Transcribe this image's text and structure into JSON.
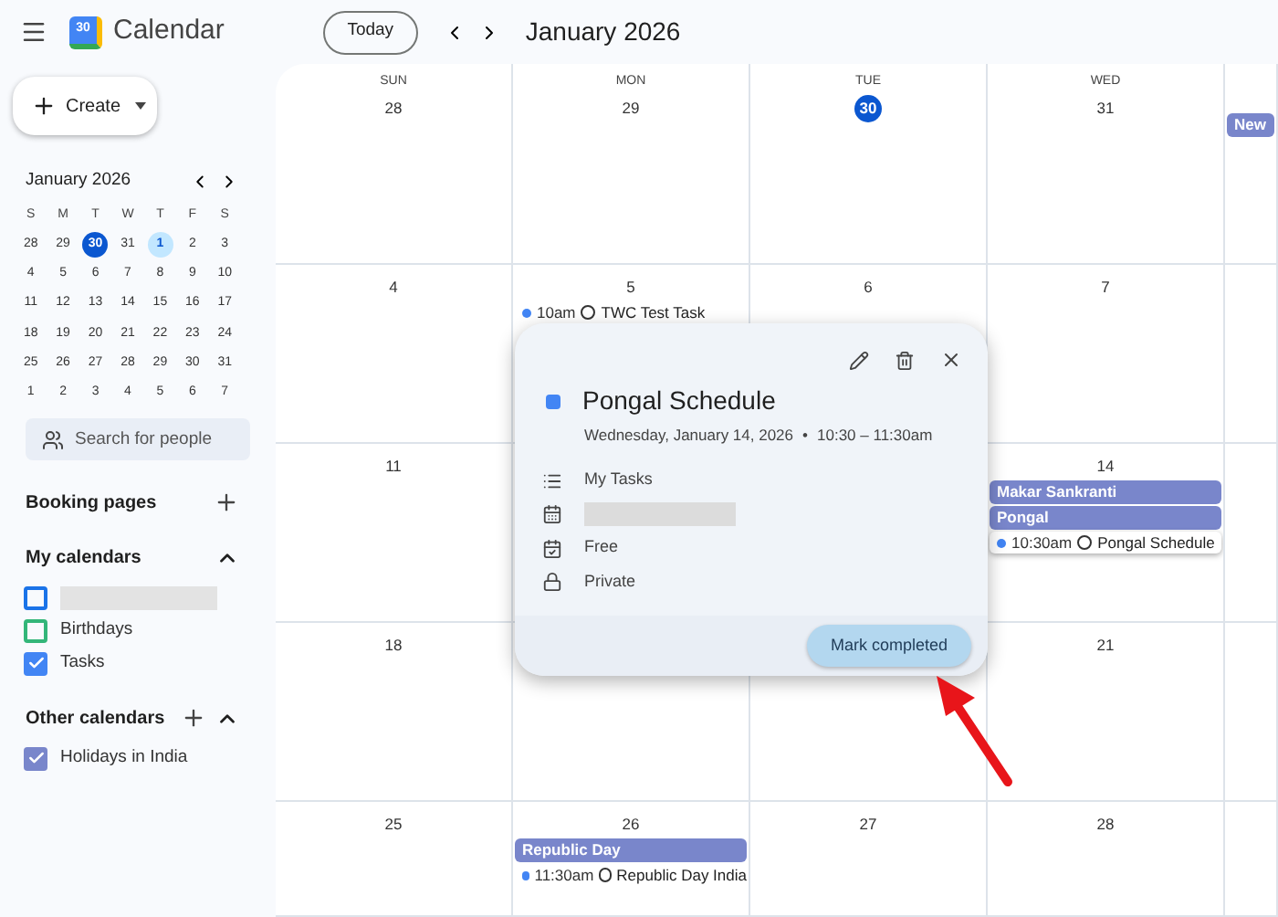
{
  "header": {
    "logo_text": "30",
    "app_name": "Calendar",
    "today_button": "Today",
    "period": "January 2026"
  },
  "sidebar": {
    "create_button": "Create",
    "mini_calendar": {
      "title": "January 2026",
      "weekdays": [
        "S",
        "M",
        "T",
        "W",
        "T",
        "F",
        "S"
      ],
      "weeks": [
        [
          {
            "day": "28",
            "today": false,
            "selected": false
          },
          {
            "day": "29",
            "today": false,
            "selected": false
          },
          {
            "day": "30",
            "today": true,
            "selected": false
          },
          {
            "day": "31",
            "today": false,
            "selected": false
          },
          {
            "day": "1",
            "today": false,
            "selected": true
          },
          {
            "day": "2",
            "today": false,
            "selected": false
          },
          {
            "day": "3",
            "today": false,
            "selected": false
          }
        ],
        [
          {
            "day": "4",
            "today": false,
            "selected": false
          },
          {
            "day": "5",
            "today": false,
            "selected": false
          },
          {
            "day": "6",
            "today": false,
            "selected": false
          },
          {
            "day": "7",
            "today": false,
            "selected": false
          },
          {
            "day": "8",
            "today": false,
            "selected": false
          },
          {
            "day": "9",
            "today": false,
            "selected": false
          },
          {
            "day": "10",
            "today": false,
            "selected": false
          }
        ],
        [
          {
            "day": "11",
            "today": false,
            "selected": false
          },
          {
            "day": "12",
            "today": false,
            "selected": false
          },
          {
            "day": "13",
            "today": false,
            "selected": false
          },
          {
            "day": "14",
            "today": false,
            "selected": false
          },
          {
            "day": "15",
            "today": false,
            "selected": false
          },
          {
            "day": "16",
            "today": false,
            "selected": false
          },
          {
            "day": "17",
            "today": false,
            "selected": false
          }
        ],
        [
          {
            "day": "18",
            "today": false,
            "selected": false
          },
          {
            "day": "19",
            "today": false,
            "selected": false
          },
          {
            "day": "20",
            "today": false,
            "selected": false
          },
          {
            "day": "21",
            "today": false,
            "selected": false
          },
          {
            "day": "22",
            "today": false,
            "selected": false
          },
          {
            "day": "23",
            "today": false,
            "selected": false
          },
          {
            "day": "24",
            "today": false,
            "selected": false
          }
        ],
        [
          {
            "day": "25",
            "today": false,
            "selected": false
          },
          {
            "day": "26",
            "today": false,
            "selected": false
          },
          {
            "day": "27",
            "today": false,
            "selected": false
          },
          {
            "day": "28",
            "today": false,
            "selected": false
          },
          {
            "day": "29",
            "today": false,
            "selected": false
          },
          {
            "day": "30",
            "today": false,
            "selected": false
          },
          {
            "day": "31",
            "today": false,
            "selected": false
          }
        ],
        [
          {
            "day": "1",
            "today": false,
            "selected": false
          },
          {
            "day": "2",
            "today": false,
            "selected": false
          },
          {
            "day": "3",
            "today": false,
            "selected": false
          },
          {
            "day": "4",
            "today": false,
            "selected": false
          },
          {
            "day": "5",
            "today": false,
            "selected": false
          },
          {
            "day": "6",
            "today": false,
            "selected": false
          },
          {
            "day": "7",
            "today": false,
            "selected": false
          }
        ]
      ]
    },
    "search_placeholder": "Search for people",
    "booking_pages": "Booking pages",
    "my_calendars": {
      "title": "My calendars",
      "expanded": true,
      "items": [
        {
          "redacted": true,
          "checked": false,
          "color": "#1a73e8"
        },
        {
          "label": "Birthdays",
          "checked": false,
          "color": "#33b679"
        },
        {
          "label": "Tasks",
          "checked": true,
          "color": "#4285f4"
        }
      ]
    },
    "other_calendars": {
      "title": "Other calendars",
      "expanded": true,
      "items": [
        {
          "label": "Holidays in India",
          "checked": true,
          "color": "#7986cb"
        }
      ]
    }
  },
  "calendar": {
    "weeks": [
      {
        "cells": [
          {
            "weekday": "SUN",
            "date": "28",
            "today": false
          },
          {
            "weekday": "MON",
            "date": "29",
            "today": false
          },
          {
            "weekday": "TUE",
            "date": "30",
            "today": true
          },
          {
            "weekday": "WED",
            "date": "31",
            "today": false
          },
          {
            "events": [
              {
                "kind": "allday",
                "title": "New",
                "color": "#7986cb"
              }
            ]
          }
        ]
      },
      {
        "cells": [
          {
            "date": "4",
            "today": false
          },
          {
            "date": "5",
            "today": false,
            "events": [
              {
                "kind": "task",
                "time": "10am",
                "title": "TWC Test Task",
                "color": "#4285f4",
                "selected": false
              }
            ]
          },
          {
            "date": "6",
            "today": false
          },
          {
            "date": "7",
            "today": false
          },
          {}
        ]
      },
      {
        "cells": [
          {
            "date": "11",
            "today": false
          },
          {},
          {},
          {
            "date": "14",
            "today": false,
            "events": [
              {
                "kind": "allday",
                "title": "Makar Sankranti",
                "color": "#7986cb"
              },
              {
                "kind": "allday",
                "title": "Pongal",
                "color": "#7986cb"
              },
              {
                "kind": "task",
                "time": "10:30am",
                "title": "Pongal Schedule",
                "color": "#4285f4",
                "selected": true
              }
            ]
          },
          {}
        ]
      },
      {
        "cells": [
          {
            "date": "18",
            "today": false
          },
          {},
          {},
          {
            "date": "21",
            "today": false
          },
          {}
        ]
      },
      {
        "cells": [
          {
            "date": "25",
            "today": false
          },
          {
            "date": "26",
            "today": false,
            "events": [
              {
                "kind": "allday",
                "title": "Republic Day",
                "color": "#7986cb"
              },
              {
                "kind": "task",
                "time": "11:30am",
                "title": "Republic Day India",
                "color": "#4285f4",
                "selected": false
              }
            ]
          },
          {
            "date": "27",
            "today": false
          },
          {
            "date": "28",
            "today": false
          },
          {}
        ]
      }
    ]
  },
  "event_popup": {
    "color": "#4285f4",
    "title": "Pongal Schedule",
    "date": "Wednesday, January 14, 2026",
    "separator": "•",
    "time": "10:30 – 11:30am",
    "details": [
      {
        "kind": "list",
        "text": "My Tasks"
      },
      {
        "kind": "calendar",
        "redacted": true
      },
      {
        "kind": "availability",
        "text": "Free"
      },
      {
        "kind": "visibility",
        "text": "Private"
      }
    ],
    "action_button": "Mark completed"
  }
}
